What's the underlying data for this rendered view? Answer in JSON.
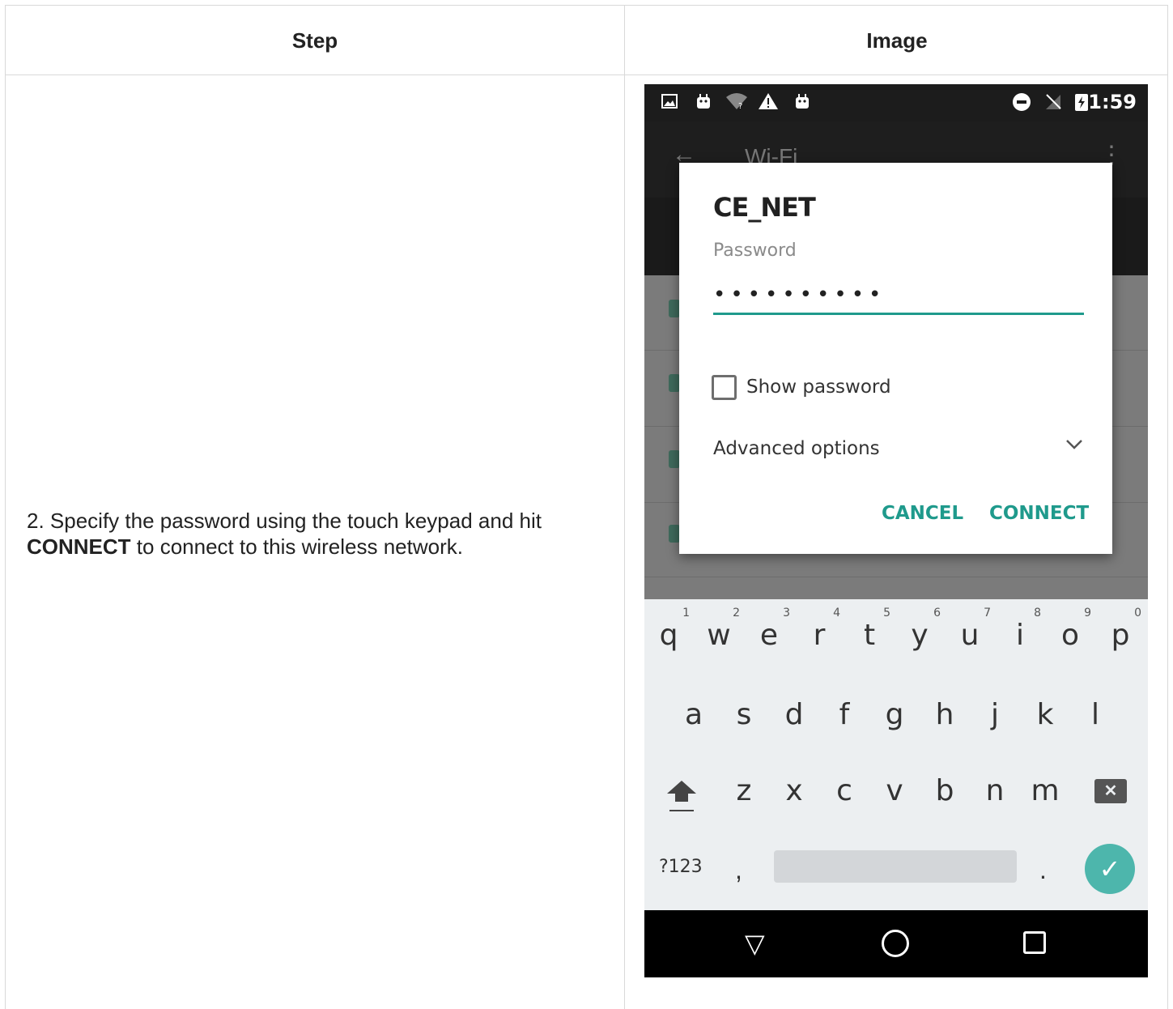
{
  "table": {
    "headers": [
      "Step",
      "Image"
    ],
    "step_text_prefix": "2. Specify the password using the touch keypad and hit ",
    "step_text_bold": "CONNECT",
    "step_text_suffix": " to connect to this wireless network."
  },
  "phone": {
    "status_time": "1:59",
    "app_title": "Wi-Fi",
    "dialog": {
      "title": "CE_NET",
      "password_label": "Password",
      "password_value": "••••••••••",
      "show_password_label": "Show password",
      "advanced_options_label": "Advanced options",
      "cancel_label": "CANCEL",
      "connect_label": "CONNECT"
    },
    "keyboard": {
      "row1": [
        "q",
        "w",
        "e",
        "r",
        "t",
        "y",
        "u",
        "i",
        "o",
        "p"
      ],
      "row1_hints": [
        "1",
        "2",
        "3",
        "4",
        "5",
        "6",
        "7",
        "8",
        "9",
        "0"
      ],
      "row2": [
        "a",
        "s",
        "d",
        "f",
        "g",
        "h",
        "j",
        "k",
        "l"
      ],
      "row3": [
        "z",
        "x",
        "c",
        "v",
        "b",
        "n",
        "m"
      ],
      "symbols_key": "?123",
      "comma": ",",
      "period": "."
    },
    "icons": {
      "status": [
        "image-icon",
        "android-icon",
        "wifi-icon",
        "warning-icon",
        "android-icon",
        "dnd-icon",
        "no-sim-icon",
        "battery-charging-icon"
      ],
      "nav": [
        "back-triangle-icon",
        "home-circle-icon",
        "recents-square-icon"
      ]
    },
    "accent_color": "#1f9a8c"
  }
}
